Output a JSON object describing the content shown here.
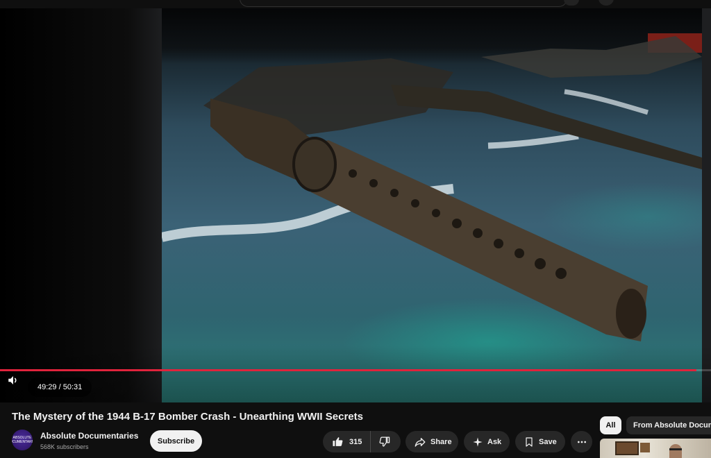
{
  "video": {
    "title": "The Mystery of the 1944 B-17 Bomber Crash - Unearthing WWII Secrets",
    "time": {
      "current": "49:29",
      "total": "50:31",
      "separator": " / "
    },
    "progress": 0.9796
  },
  "channel": {
    "name": "Absolute Documentaries",
    "subscribers": "568K subscribers",
    "avatar_text": "ABSOLUTE DOCUMENTARIES"
  },
  "actions": {
    "subscribe_label": "Subscribe",
    "like_count": "315",
    "share_label": "Share",
    "ask_label": "Ask",
    "save_label": "Save"
  },
  "filters": [
    {
      "label": "All",
      "selected": true
    },
    {
      "label": "From Absolute Documentaries",
      "selected": false
    }
  ],
  "icons": {
    "volume": "volume-icon",
    "like": "thumbs-up-icon",
    "dislike": "thumbs-down-icon",
    "share": "share-arrow-icon",
    "ask": "sparkle-icon",
    "save": "bookmark-icon",
    "more": "more-horizontal-icon"
  },
  "colors": {
    "progress": "#e0233c",
    "background": "#0f0f0f",
    "pill": "#272727",
    "subscribe_bg": "#f1f1f1"
  }
}
